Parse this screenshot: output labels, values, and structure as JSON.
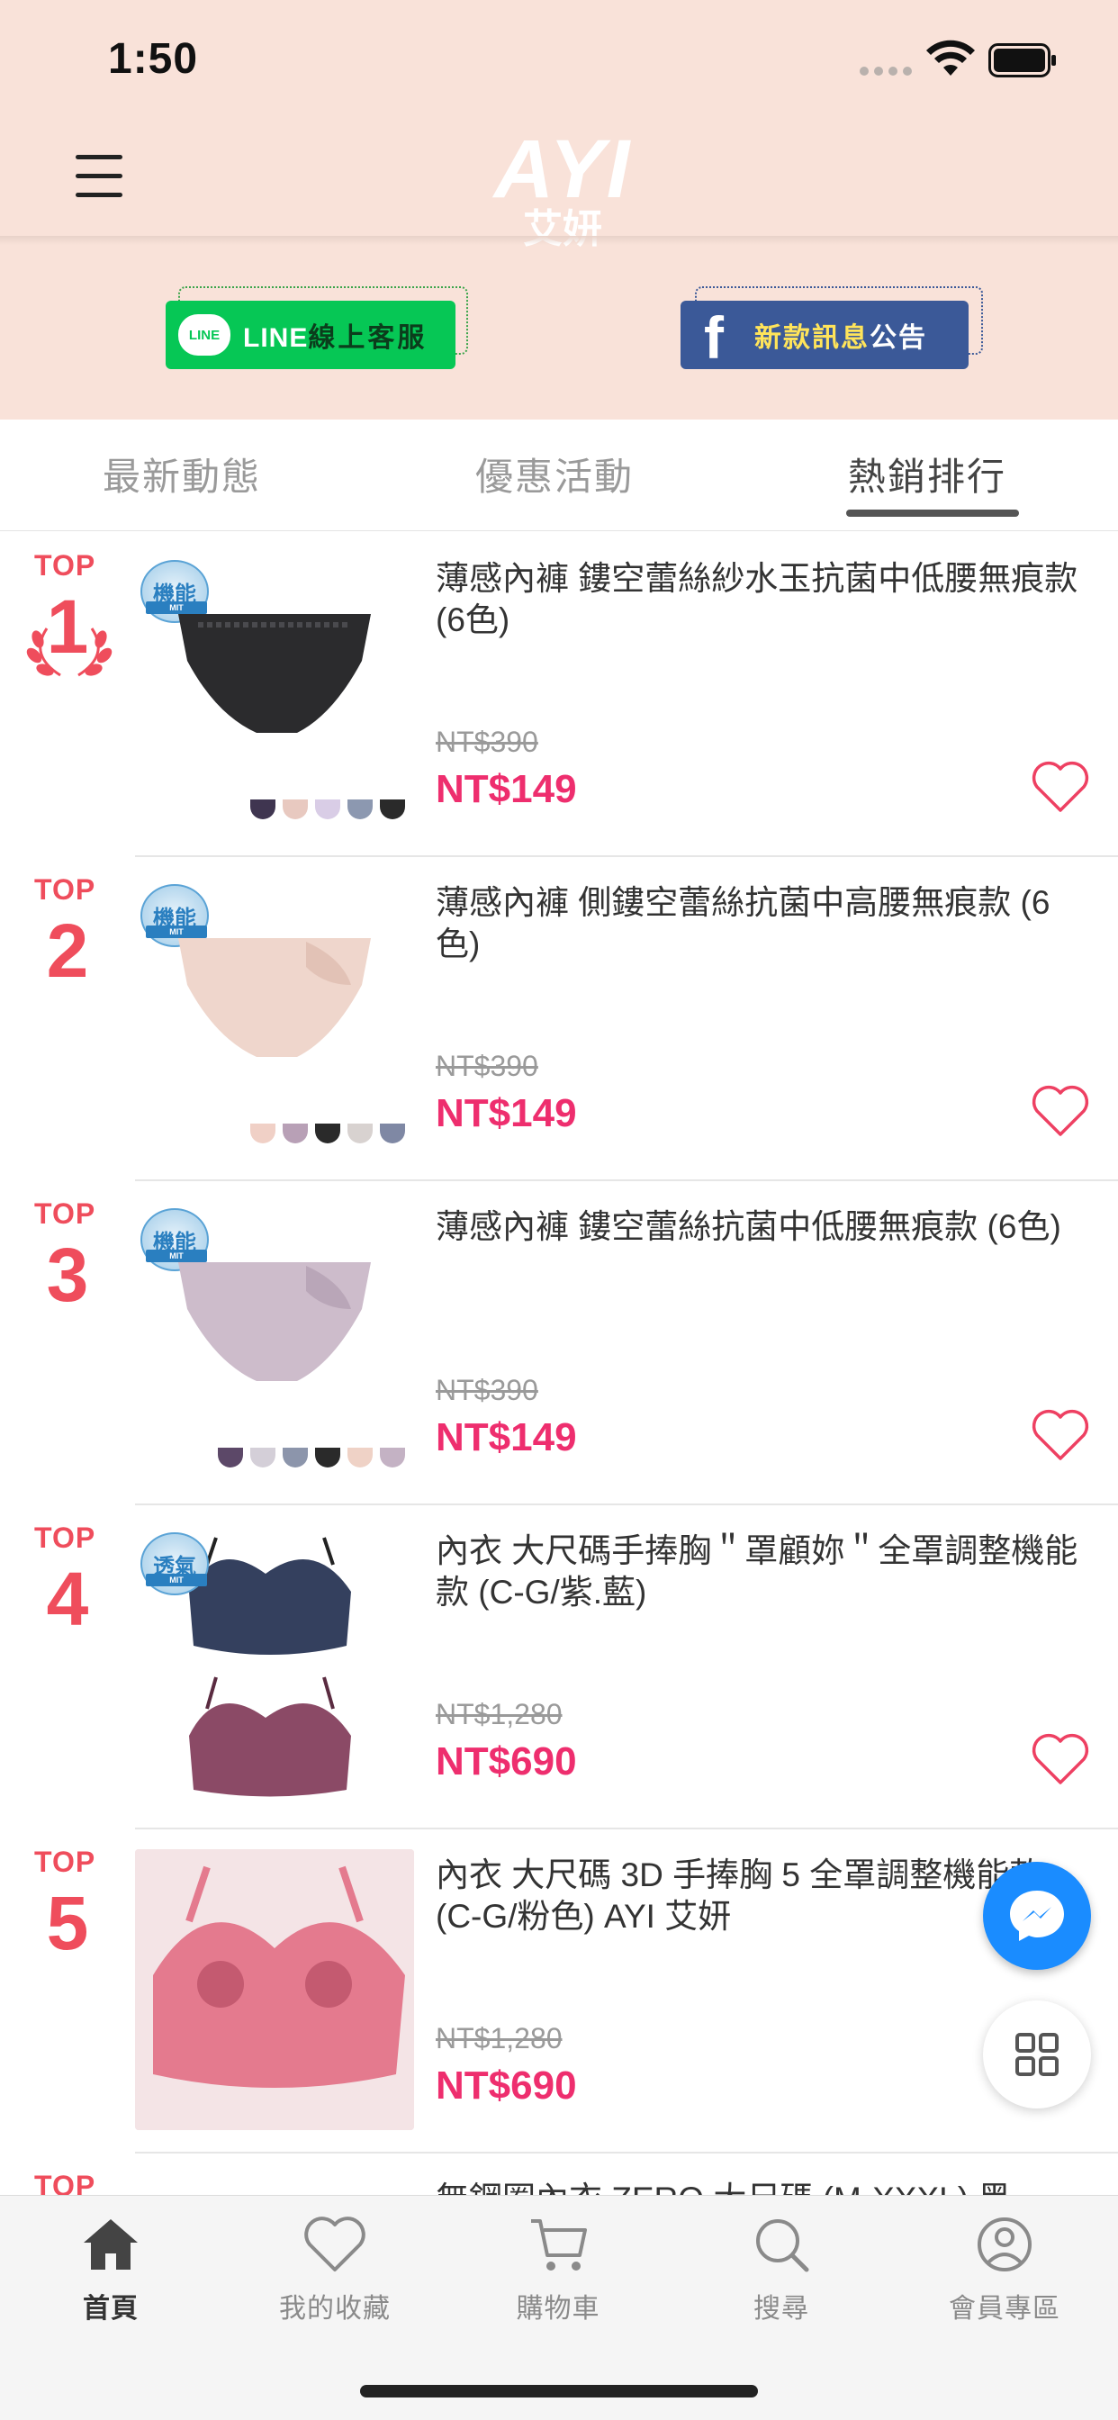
{
  "status_bar": {
    "time": "1:50"
  },
  "brand": {
    "logo_text": "AYI",
    "logo_sub": "艾妍"
  },
  "promo": {
    "line_label": "LINE",
    "line_sub": "線上客服",
    "line_bubble": "LINE",
    "fb_highlight": "新款訊息",
    "fb_rest": "公告"
  },
  "tabs": [
    {
      "label": "最新動態"
    },
    {
      "label": "優惠活動"
    },
    {
      "label": "熱銷排行"
    }
  ],
  "rank_prefix": "TOP",
  "products": [
    {
      "rank": "1",
      "badge": "機能",
      "title": "薄感內褲 鏤空蕾絲紗水玉抗菌中低腰無痕款 (6色)",
      "orig_price": "NT$390",
      "price": "NT$149"
    },
    {
      "rank": "2",
      "badge": "機能",
      "title": "薄感內褲 側鏤空蕾絲抗菌中高腰無痕款 (6色)",
      "orig_price": "NT$390",
      "price": "NT$149"
    },
    {
      "rank": "3",
      "badge": "機能",
      "title": "薄感內褲 鏤空蕾絲抗菌中低腰無痕款 (6色)",
      "orig_price": "NT$390",
      "price": "NT$149"
    },
    {
      "rank": "4",
      "badge": "透氣",
      "title": "內衣 大尺碼手捧胸＂罩顧妳＂全罩調整機能款 (C-G/紫.藍)",
      "orig_price": "NT$1,280",
      "price": "NT$690"
    },
    {
      "rank": "5",
      "badge": "",
      "title": "內衣 大尺碼 3D 手捧胸 5 全罩調整機能款 (C-G/粉色) AYI 艾妍",
      "orig_price": "NT$1,280",
      "price": "NT$690"
    },
    {
      "rank": "",
      "badge": "",
      "title": "無鋼圈內衣 ZERO 大尺碼 (M-XXXL) 黑",
      "orig_price": "",
      "price": ""
    }
  ],
  "bottom_nav": [
    {
      "label": "首頁",
      "icon": "home-icon"
    },
    {
      "label": "我的收藏",
      "icon": "heart-icon"
    },
    {
      "label": "購物車",
      "icon": "cart-icon"
    },
    {
      "label": "搜尋",
      "icon": "search-icon"
    },
    {
      "label": "會員專區",
      "icon": "user-icon"
    }
  ],
  "colors": {
    "header_bg": "#f9e2d9",
    "rank": "#ef4d5c",
    "price": "#ee2e6e",
    "line_green": "#06c755",
    "facebook_blue": "#3b5998",
    "messenger_blue": "#1a8cff"
  }
}
